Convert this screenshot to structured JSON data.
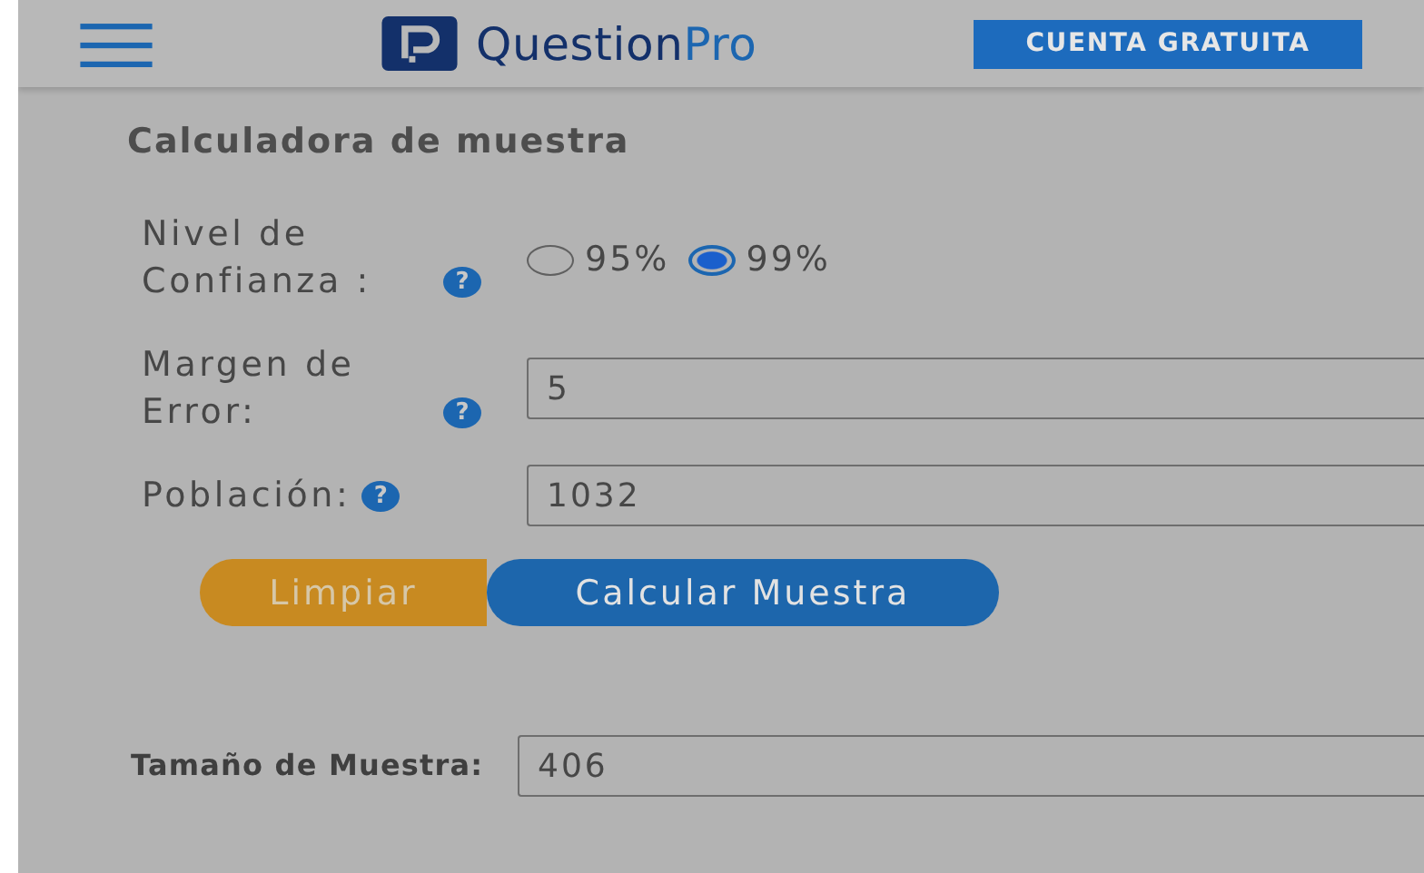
{
  "header": {
    "logo_text": "Question",
    "logo_accent": "Pro",
    "cta": "CUENTA GRATUITA"
  },
  "title": "Calculadora de muestra",
  "confidence": {
    "label": "Nivel de Confianza :",
    "help": "?",
    "options": [
      {
        "label": "95%",
        "selected": false
      },
      {
        "label": "99%",
        "selected": true
      }
    ]
  },
  "fields": [
    {
      "label": "Margen de Error:",
      "help": "?",
      "value": "5"
    },
    {
      "label": "Población:",
      "help": "?",
      "value": "1032"
    }
  ],
  "buttons": [
    {
      "label": "Limpiar",
      "kind": "secondary"
    },
    {
      "label": "Calcular Muestra",
      "kind": "primary"
    }
  ],
  "result": {
    "label": "Tamaño de Muestra:",
    "value": "406"
  }
}
